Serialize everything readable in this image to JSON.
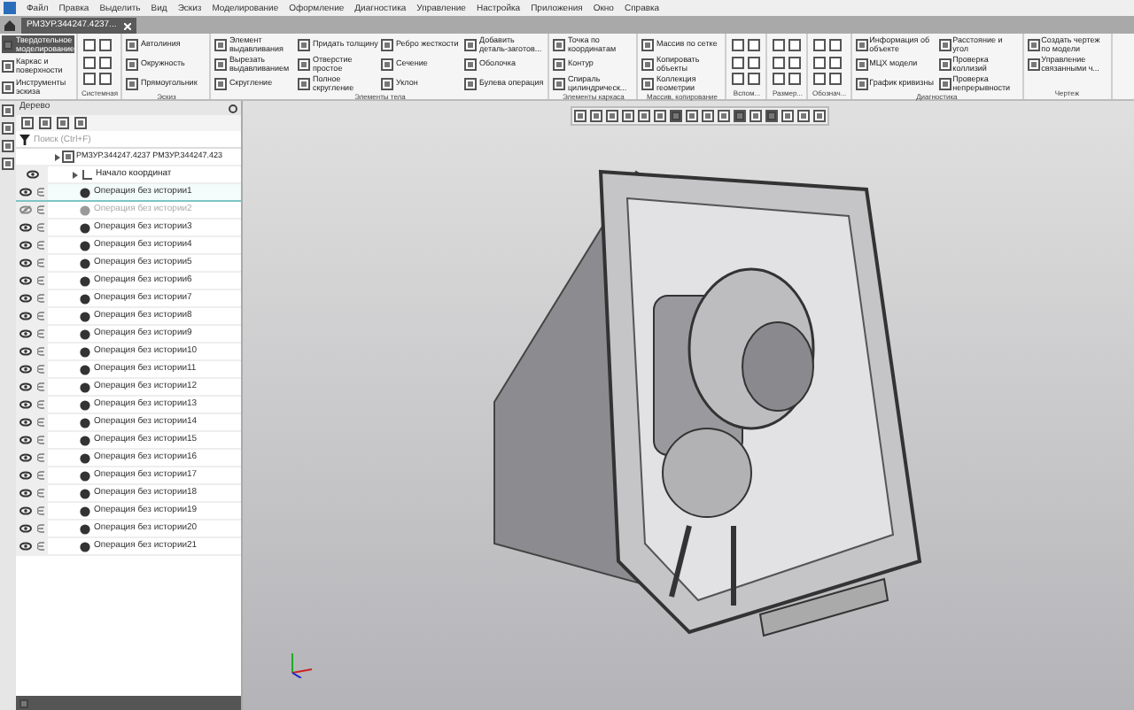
{
  "menu": [
    "Файл",
    "Правка",
    "Выделить",
    "Вид",
    "Эскиз",
    "Моделирование",
    "Оформление",
    "Диагностика",
    "Управление",
    "Настройка",
    "Приложения",
    "Окно",
    "Справка"
  ],
  "tabs": [
    {
      "label": "РМЗУР.344247.4237...",
      "selected": true
    }
  ],
  "modes": [
    {
      "label": "Твердотельное моделирование",
      "selected": true
    },
    {
      "label": "Каркас и поверхности",
      "selected": false
    },
    {
      "label": "Инструменты эскиза",
      "selected": false
    }
  ],
  "ribbon_groups": [
    {
      "kind": "icons",
      "label": "Системная"
    },
    {
      "kind": "commands",
      "label": "Эскиз",
      "items": [
        "Автолиния",
        "Окружность",
        "Прямоугольник"
      ]
    },
    {
      "kind": "commands",
      "label": "Элементы тела",
      "items": [
        "Элемент выдавливания",
        "Вырезать выдавливанием",
        "Скругление",
        "Придать толщину",
        "Отверстие простое",
        "Полное скругление",
        "Ребро жесткости",
        "Сечение",
        "Уклон",
        "Добавить деталь-заготов...",
        "Оболочка",
        "Булева операция"
      ]
    },
    {
      "kind": "commands",
      "label": "Элементы каркаса",
      "items": [
        "Точка по координатам",
        "Контур",
        "Спираль цилиндрическ..."
      ]
    },
    {
      "kind": "commands",
      "label": "Массив, копирование",
      "items": [
        "Массив по сетке",
        "Копировать объекты",
        "Коллекция геометрии"
      ]
    },
    {
      "kind": "icons",
      "label": "Вспом..."
    },
    {
      "kind": "icons",
      "label": "Размер..."
    },
    {
      "kind": "icons",
      "label": "Обознач..."
    },
    {
      "kind": "commands",
      "label": "Диагностика",
      "items": [
        "Информация об объекте",
        "МЦХ модели",
        "График кривизны",
        "Расстояние и угол",
        "Проверка коллизий",
        "Проверка непрерывности"
      ]
    },
    {
      "kind": "commands",
      "label": "Чертеж",
      "items": [
        "Создать чертеж по модели",
        "Управление связанными ч..."
      ]
    }
  ],
  "tree": {
    "title": "Дерево",
    "search": {
      "placeholder": "Поиск (Ctrl+F)"
    },
    "root": "РМЗУР.344247.4237 РМЗУР.344247.423",
    "origin": "Начало координат",
    "items": [
      {
        "label": "Операция без истории1",
        "visible": true,
        "selected": true
      },
      {
        "label": "Операция без истории2",
        "visible": false,
        "selected": false
      },
      {
        "label": "Операция без истории3",
        "visible": true,
        "selected": false
      },
      {
        "label": "Операция без истории4",
        "visible": true,
        "selected": false
      },
      {
        "label": "Операция без истории5",
        "visible": true,
        "selected": false
      },
      {
        "label": "Операция без истории6",
        "visible": true,
        "selected": false
      },
      {
        "label": "Операция без истории7",
        "visible": true,
        "selected": false
      },
      {
        "label": "Операция без истории8",
        "visible": true,
        "selected": false
      },
      {
        "label": "Операция без истории9",
        "visible": true,
        "selected": false
      },
      {
        "label": "Операция без истории10",
        "visible": true,
        "selected": false
      },
      {
        "label": "Операция без истории11",
        "visible": true,
        "selected": false
      },
      {
        "label": "Операция без истории12",
        "visible": true,
        "selected": false
      },
      {
        "label": "Операция без истории13",
        "visible": true,
        "selected": false
      },
      {
        "label": "Операция без истории14",
        "visible": true,
        "selected": false
      },
      {
        "label": "Операция без истории15",
        "visible": true,
        "selected": false
      },
      {
        "label": "Операция без истории16",
        "visible": true,
        "selected": false
      },
      {
        "label": "Операция без истории17",
        "visible": true,
        "selected": false
      },
      {
        "label": "Операция без истории18",
        "visible": true,
        "selected": false
      },
      {
        "label": "Операция без истории19",
        "visible": true,
        "selected": false
      },
      {
        "label": "Операция без истории20",
        "visible": true,
        "selected": false
      },
      {
        "label": "Операция без истории21",
        "visible": true,
        "selected": false
      }
    ]
  }
}
